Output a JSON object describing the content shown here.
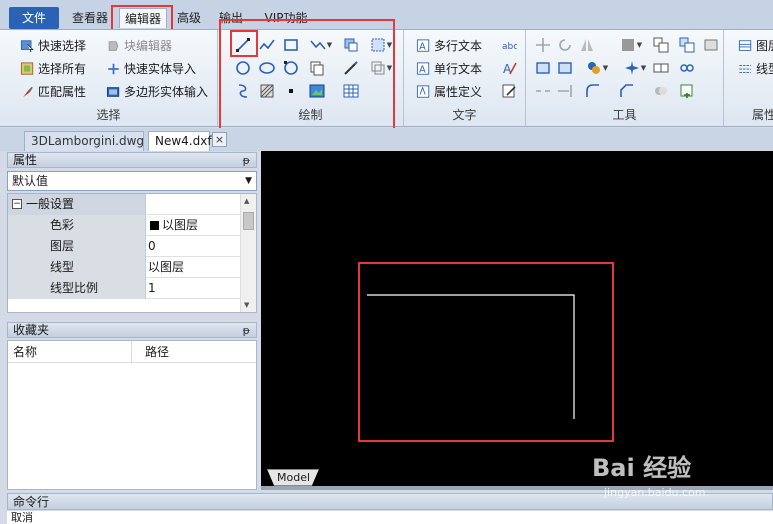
{
  "menu": {
    "tabs": [
      "文件",
      "查看器",
      "编辑器",
      "高级",
      "输出",
      "VIP功能"
    ],
    "active": "编辑器"
  },
  "ribbon": {
    "select_group": {
      "label": "选择",
      "quick_select": "快速选择",
      "select_all": "选择所有",
      "match_props": "匹配属性",
      "block_editor": "块编辑器",
      "quick_entity_import": "快速实体导入",
      "polygon_entity_input": "多边形实体输入"
    },
    "draw_group": {
      "label": "绘制",
      "tools": [
        "line-icon",
        "polyline-icon",
        "rectangle-icon",
        "spline-icon",
        "insert-block-icon",
        "region-icon",
        "circle-icon",
        "ellipse-icon",
        "arc-icon",
        "copy-icon",
        "pen-icon",
        "offset-icon",
        "helix-icon",
        "hatch-icon",
        "point-icon",
        "image-icon",
        "table-icon"
      ]
    },
    "text_group": {
      "label": "文字",
      "mtext": "多行文本",
      "text": "单行文本",
      "attdef": "属性定义"
    },
    "tools_group": {
      "label": "工具"
    },
    "props_group": {
      "label": "属性",
      "item1": "图层",
      "item2": "线型"
    }
  },
  "documents": {
    "tabs": [
      "3DLamborgini.dwg",
      "New4.dxf"
    ],
    "active": "New4.dxf",
    "close": "×"
  },
  "properties_panel": {
    "title": "属性",
    "pin": "ᵽ",
    "dropdown_value": "默认值",
    "group_label": "一般设置",
    "group_toggle": "−",
    "rows": [
      {
        "key": "色彩",
        "value": "以图层",
        "swatch": "#000000"
      },
      {
        "key": "图层",
        "value": "0"
      },
      {
        "key": "线型",
        "value": "以图层"
      },
      {
        "key": "线型比例",
        "value": "1"
      }
    ]
  },
  "favorites_panel": {
    "title": "收藏夹",
    "pin": "ᵽ",
    "col_name": "名称",
    "col_path": "路径"
  },
  "canvas": {
    "model_tab": "Model",
    "background": "#000000"
  },
  "command": {
    "title": "命令行",
    "output": "取消"
  },
  "watermark": {
    "logo": "Bai 经验",
    "url": "jingyan.baidu.com"
  },
  "colors": {
    "file_tab": "#2a63b6",
    "highlight": "#e23a3a",
    "icon_blue": "#2b62b8"
  }
}
